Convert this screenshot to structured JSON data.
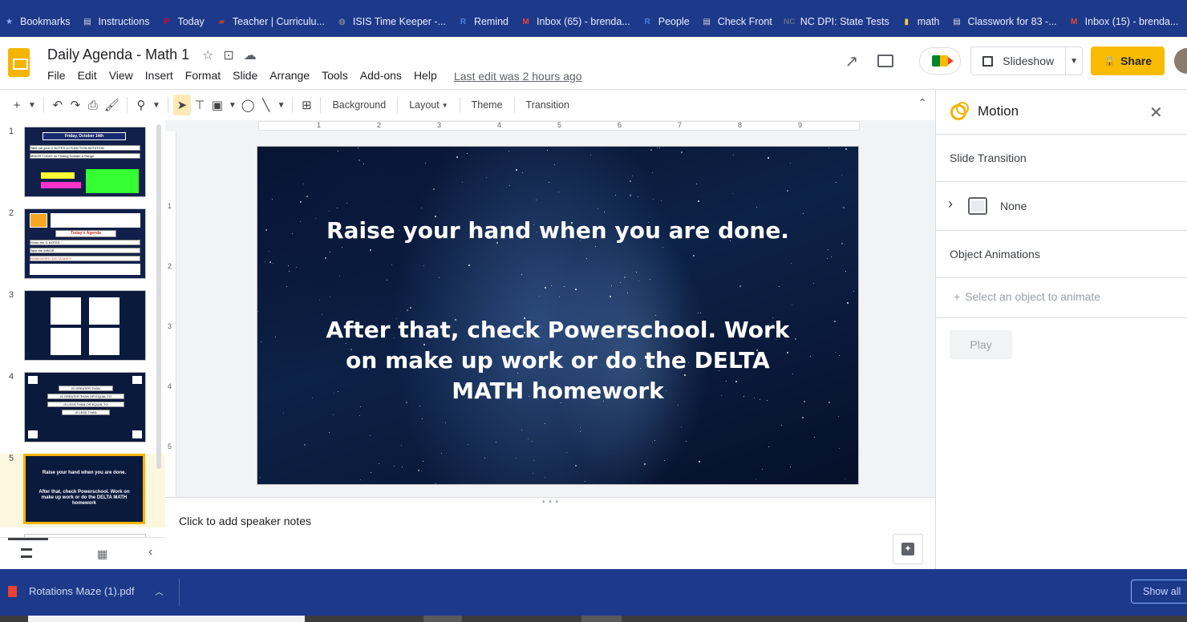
{
  "bookmarks": [
    {
      "label": "Bookmarks",
      "icon": "star-icon",
      "color": "#8ab4f8"
    },
    {
      "label": "Instructions",
      "icon": "page-icon",
      "color": "#dadce0"
    },
    {
      "label": "Today",
      "icon": "pinterest-icon",
      "color": "#e60023"
    },
    {
      "label": "Teacher | Curriculu...",
      "icon": "flag-icon",
      "color": "#c0392b"
    },
    {
      "label": "ISIS Time Keeper -...",
      "icon": "globe-icon",
      "color": "#9aa0a6"
    },
    {
      "label": "Remind",
      "icon": "remind-icon",
      "color": "#4a7ee8"
    },
    {
      "label": "Inbox (65) - brenda...",
      "icon": "gmail-icon",
      "color": "#ea4335"
    },
    {
      "label": "People",
      "icon": "remind-icon",
      "color": "#4a7ee8"
    },
    {
      "label": "Check Front",
      "icon": "page-icon",
      "color": "#dadce0"
    },
    {
      "label": "NC DPI: State Tests",
      "icon": "nc-icon",
      "color": "#5f6a8a"
    },
    {
      "label": "math",
      "icon": "folder-icon",
      "color": "#fbcb46"
    },
    {
      "label": "Classwork for 83 -...",
      "icon": "classroom-icon",
      "color": "#dadce0"
    },
    {
      "label": "Inbox (15) - brenda...",
      "icon": "gmail-icon",
      "color": "#ea4335"
    }
  ],
  "header": {
    "title": "Daily Agenda - Math 1",
    "menu": [
      "File",
      "Edit",
      "View",
      "Insert",
      "Format",
      "Slide",
      "Arrange",
      "Tools",
      "Add-ons",
      "Help"
    ],
    "last_edit": "Last edit was 2 hours ago",
    "slideshow_label": "Slideshow",
    "share_label": "Share",
    "accent": "#f9bc02"
  },
  "toolbar": {
    "background_label": "Background",
    "layout_label": "Layout",
    "theme_label": "Theme",
    "transition_label": "Transition"
  },
  "filmstrip": {
    "slides": [
      {
        "num": "1",
        "title": "Friday, October 14th",
        "rows": [
          "Take out your G NOTES on FUNCTION NOTATION",
          "MINOR TODAY on Finding Domain & Range"
        ]
      },
      {
        "num": "2",
        "title": "Today's Agenda",
        "rows": [
          "Finish the G NOTES",
          "Take the MINOR",
          "HOMEWORK: DELTA MATH"
        ]
      },
      {
        "num": "3"
      },
      {
        "num": "4",
        "rows": [
          "IS GREATER THAN",
          "IS GREATER THAN OR EQUAL TO",
          "IS LESS THAN OR EQUAL TO",
          "IS LESS THAN"
        ]
      },
      {
        "num": "5",
        "line1": "Raise your hand when you are done.",
        "line2": "After that, check Powerschool.  Work on make up work or do the DELTA MATH homework"
      }
    ]
  },
  "ruler": {
    "h_ticks": [
      "1",
      "2",
      "3",
      "4",
      "5",
      "6",
      "7",
      "8",
      "9"
    ],
    "v_ticks": [
      "1",
      "2",
      "3",
      "4",
      "5"
    ]
  },
  "slide": {
    "line1": "Raise your hand when you are done.",
    "line2": "After that, check Powerschool.  Work on make up work or do the DELTA MATH homework"
  },
  "notes": {
    "placeholder": "Click to add speaker notes"
  },
  "motion": {
    "title": "Motion",
    "slide_transition_label": "Slide Transition",
    "transition_value": "None",
    "object_animations_label": "Object Animations",
    "select_object": "Select an object to animate",
    "play_label": "Play"
  },
  "downloads": {
    "file": "Rotations Maze (1).pdf",
    "show_all": "Show all"
  }
}
